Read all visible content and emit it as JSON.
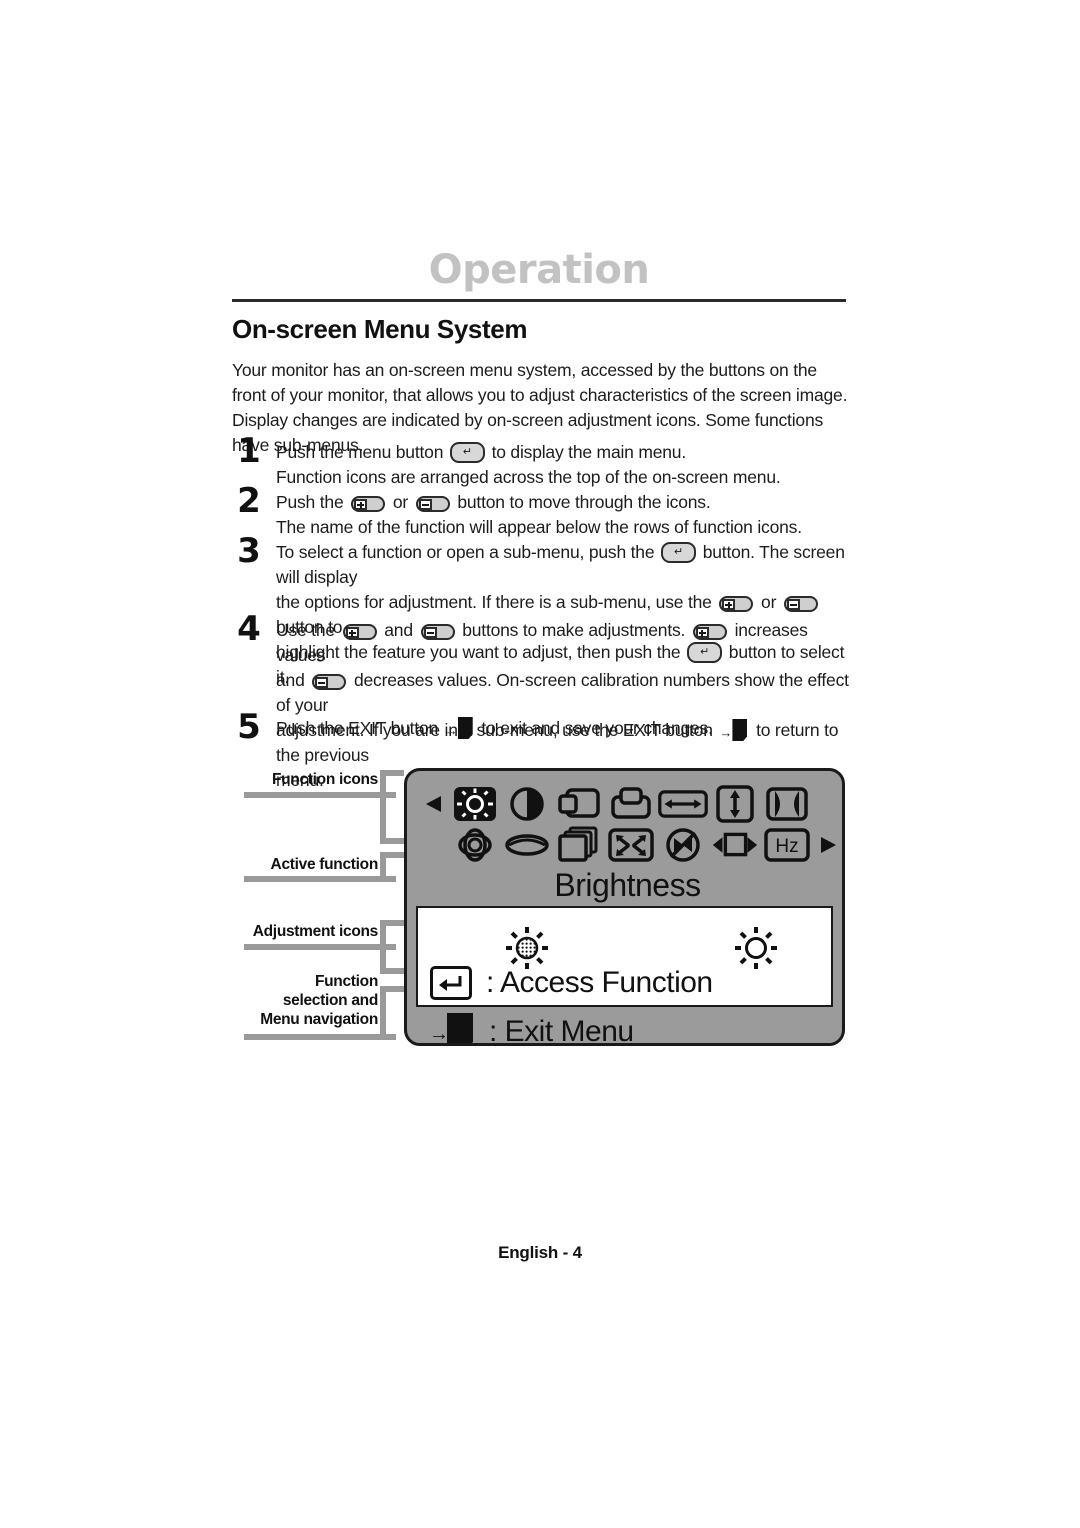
{
  "header": {
    "chapter": "Operation",
    "section": "On-screen Menu System"
  },
  "intro": "Your monitor has an on-screen menu system, accessed by the buttons on the front of your monitor, that allows you to adjust characteristics of the screen image. Display changes are indicated by on-screen adjustment icons. Some functions have sub-menus.",
  "steps": [
    {
      "number": "1",
      "part1": "Push the menu button",
      "part2": "to display the main menu.",
      "line2": "Function icons are arranged across the top of the on-screen menu."
    },
    {
      "number": "2",
      "part1": "Push the",
      "part2": "or",
      "part3": "button to move through the icons.",
      "line2": "The name of the function will appear below the rows of function icons."
    },
    {
      "number": "3",
      "part1": "To select a function or open a sub-menu, push the",
      "part2": "button. The screen will display",
      "part3": "the options for adjustment. If there is a sub-menu, use the",
      "part4": "or",
      "part5": "button to",
      "part6": "highlight the feature you want to adjust, then push the",
      "part7": "button to select it."
    },
    {
      "number": "4",
      "part1": "Use the",
      "part2": "and",
      "part3": "buttons to make adjustments.",
      "part4": "increases values",
      "part5": "and",
      "part6": "decreases values. On-screen calibration numbers show the effect of your",
      "part7": "adjustment. If you are in a sub-menu, use the EXIT button",
      "part8": "to return to the previous",
      "part9": "menu."
    },
    {
      "number": "5",
      "part1": "Push the EXIT button",
      "part2": "to exit and save your changes."
    }
  ],
  "callouts": [
    {
      "label": "Function icons"
    },
    {
      "label": "Active function"
    },
    {
      "label": "Adjustment icons"
    },
    {
      "label_line1": "Function",
      "label_line2": "selection and",
      "label_line3": "Menu navigation"
    }
  ],
  "osd": {
    "function_icons_row1": [
      "brightness-icon",
      "contrast-icon",
      "horizontal-position-icon",
      "vertical-position-icon",
      "horizontal-size-icon",
      "vertical-size-icon",
      "pincushion-icon"
    ],
    "function_icons_row2": [
      "rotation-icon",
      "trapezoid-icon",
      "moire-icon",
      "zoom-icon",
      "degauss-icon",
      "osd-position-icon",
      "frequency-hz-icon"
    ],
    "hz_label": "Hz",
    "active_function_name": "Brightness",
    "adjustment_icons": [
      "brightness-low-icon",
      "brightness-high-icon"
    ],
    "access_label": ": Access Function",
    "exit_label": ": Exit Menu",
    "highlight_color": "#111111",
    "panel_color": "#9b9b9b"
  },
  "footer": "English - 4"
}
